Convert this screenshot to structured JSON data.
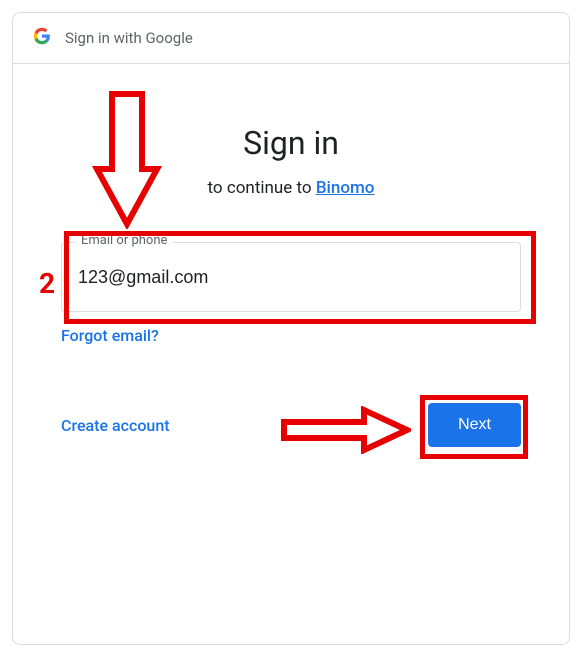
{
  "header": {
    "title": "Sign in with Google"
  },
  "main": {
    "title": "Sign in",
    "continue_prefix": "to continue to ",
    "continue_app": "Binomo",
    "email_label": "Email or phone",
    "email_value": "123@gmail.com",
    "forgot_label": "Forgot email?",
    "create_label": "Create account",
    "next_label": "Next"
  },
  "annotations": {
    "step_number": "2"
  }
}
